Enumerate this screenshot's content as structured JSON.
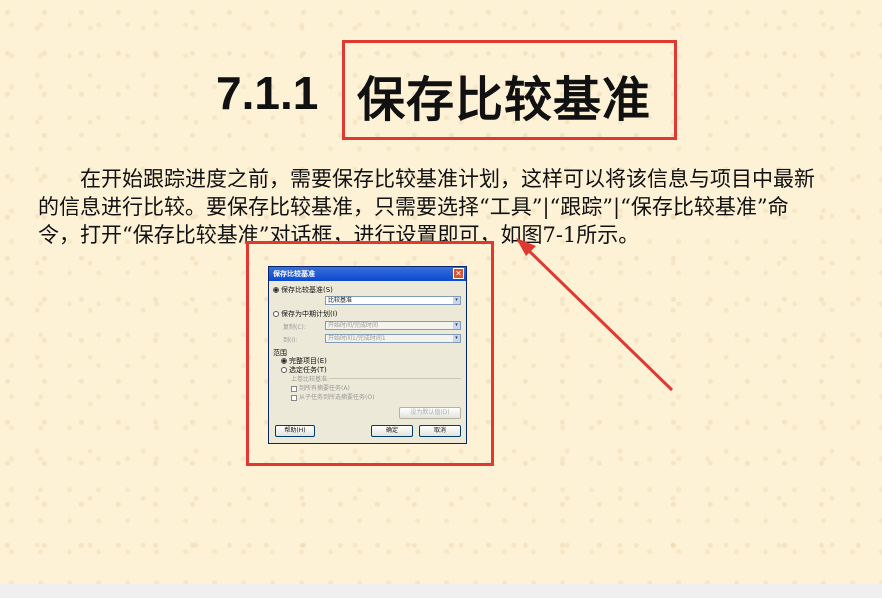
{
  "heading": {
    "number": "7.1.1",
    "text": "保存比较基准"
  },
  "paragraph": "在开始跟踪进度之前，需要保存比较基准计划，这样可以将该信息与项目中最新的信息进行比较。要保存比较基准，只需要选择“工具”|“跟踪”|“保存比较基准”命令，打开“保存比较基准”对话框，进行设置即可，如图7-1所示。",
  "dialog": {
    "title": "保存比较基准",
    "close_glyph": "✕",
    "option_save_baseline": "保存比较基准(S)",
    "baseline_select": "比较基准",
    "option_save_interim": "保存为中期计划(I)",
    "copy_label": "复制(C):",
    "copy_value": "开始时间/完成时间",
    "into_label": "到(I):",
    "into_value": "开始时间1/完成时间1",
    "scope_label": "范围",
    "scope_entire": "完整项目(E)",
    "scope_selected": "选定任务(T)",
    "rollup_label": "上卷比较基准:",
    "rollup_all": "到所有摘要任务(A)",
    "rollup_from": "从子任务到所选摘要任务(O)",
    "set_default": "设为默认值(D)",
    "help": "帮助(H)",
    "ok": "确定",
    "cancel": "取消"
  },
  "colors": {
    "highlight": "#e03a30",
    "background": "#fdf1d6"
  }
}
